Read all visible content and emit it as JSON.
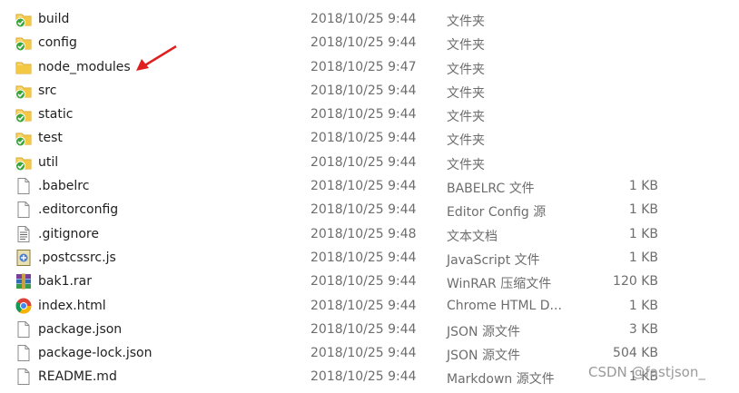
{
  "files": [
    {
      "name": "build",
      "date": "2018/10/25 9:44",
      "type": "文件夹",
      "size": "",
      "icon": "folder-synced-icon"
    },
    {
      "name": "config",
      "date": "2018/10/25 9:44",
      "type": "文件夹",
      "size": "",
      "icon": "folder-synced-icon"
    },
    {
      "name": "node_modules",
      "date": "2018/10/25 9:47",
      "type": "文件夹",
      "size": "",
      "icon": "folder-icon"
    },
    {
      "name": "src",
      "date": "2018/10/25 9:44",
      "type": "文件夹",
      "size": "",
      "icon": "folder-synced-icon"
    },
    {
      "name": "static",
      "date": "2018/10/25 9:44",
      "type": "文件夹",
      "size": "",
      "icon": "folder-synced-icon"
    },
    {
      "name": "test",
      "date": "2018/10/25 9:44",
      "type": "文件夹",
      "size": "",
      "icon": "folder-synced-icon"
    },
    {
      "name": "util",
      "date": "2018/10/25 9:44",
      "type": "文件夹",
      "size": "",
      "icon": "folder-synced-icon"
    },
    {
      "name": ".babelrc",
      "date": "2018/10/25 9:44",
      "type": "BABELRC 文件",
      "size": "1 KB",
      "icon": "file-icon"
    },
    {
      "name": ".editorconfig",
      "date": "2018/10/25 9:44",
      "type": "Editor Config 源",
      "size": "1 KB",
      "icon": "file-icon"
    },
    {
      "name": ".gitignore",
      "date": "2018/10/25 9:48",
      "type": "文本文档",
      "size": "1 KB",
      "icon": "text-file-icon"
    },
    {
      "name": ".postcssrc.js",
      "date": "2018/10/25 9:44",
      "type": "JavaScript 文件",
      "size": "1 KB",
      "icon": "script-file-icon"
    },
    {
      "name": "bak1.rar",
      "date": "2018/10/25 9:44",
      "type": "WinRAR 压缩文件",
      "size": "120 KB",
      "icon": "winrar-archive-icon"
    },
    {
      "name": "index.html",
      "date": "2018/10/25 9:44",
      "type": "Chrome HTML D...",
      "size": "1 KB",
      "icon": "chrome-html-icon"
    },
    {
      "name": "package.json",
      "date": "2018/10/25 9:44",
      "type": "JSON 源文件",
      "size": "3 KB",
      "icon": "file-icon"
    },
    {
      "name": "package-lock.json",
      "date": "2018/10/25 9:44",
      "type": "JSON 源文件",
      "size": "504 KB",
      "icon": "file-icon"
    },
    {
      "name": "README.md",
      "date": "2018/10/25 9:44",
      "type": "Markdown 源文件",
      "size": "1 KB",
      "icon": "file-icon"
    }
  ],
  "annotation": {
    "icon": "red-arrow-icon",
    "color": "#e02020"
  },
  "watermark": "CSDN @fastjson_",
  "colors": {
    "folder": "#f5c843",
    "folder_dark": "#d9a520",
    "sync_check": "#3aa53a",
    "secondary_text": "#6d6d6d"
  }
}
